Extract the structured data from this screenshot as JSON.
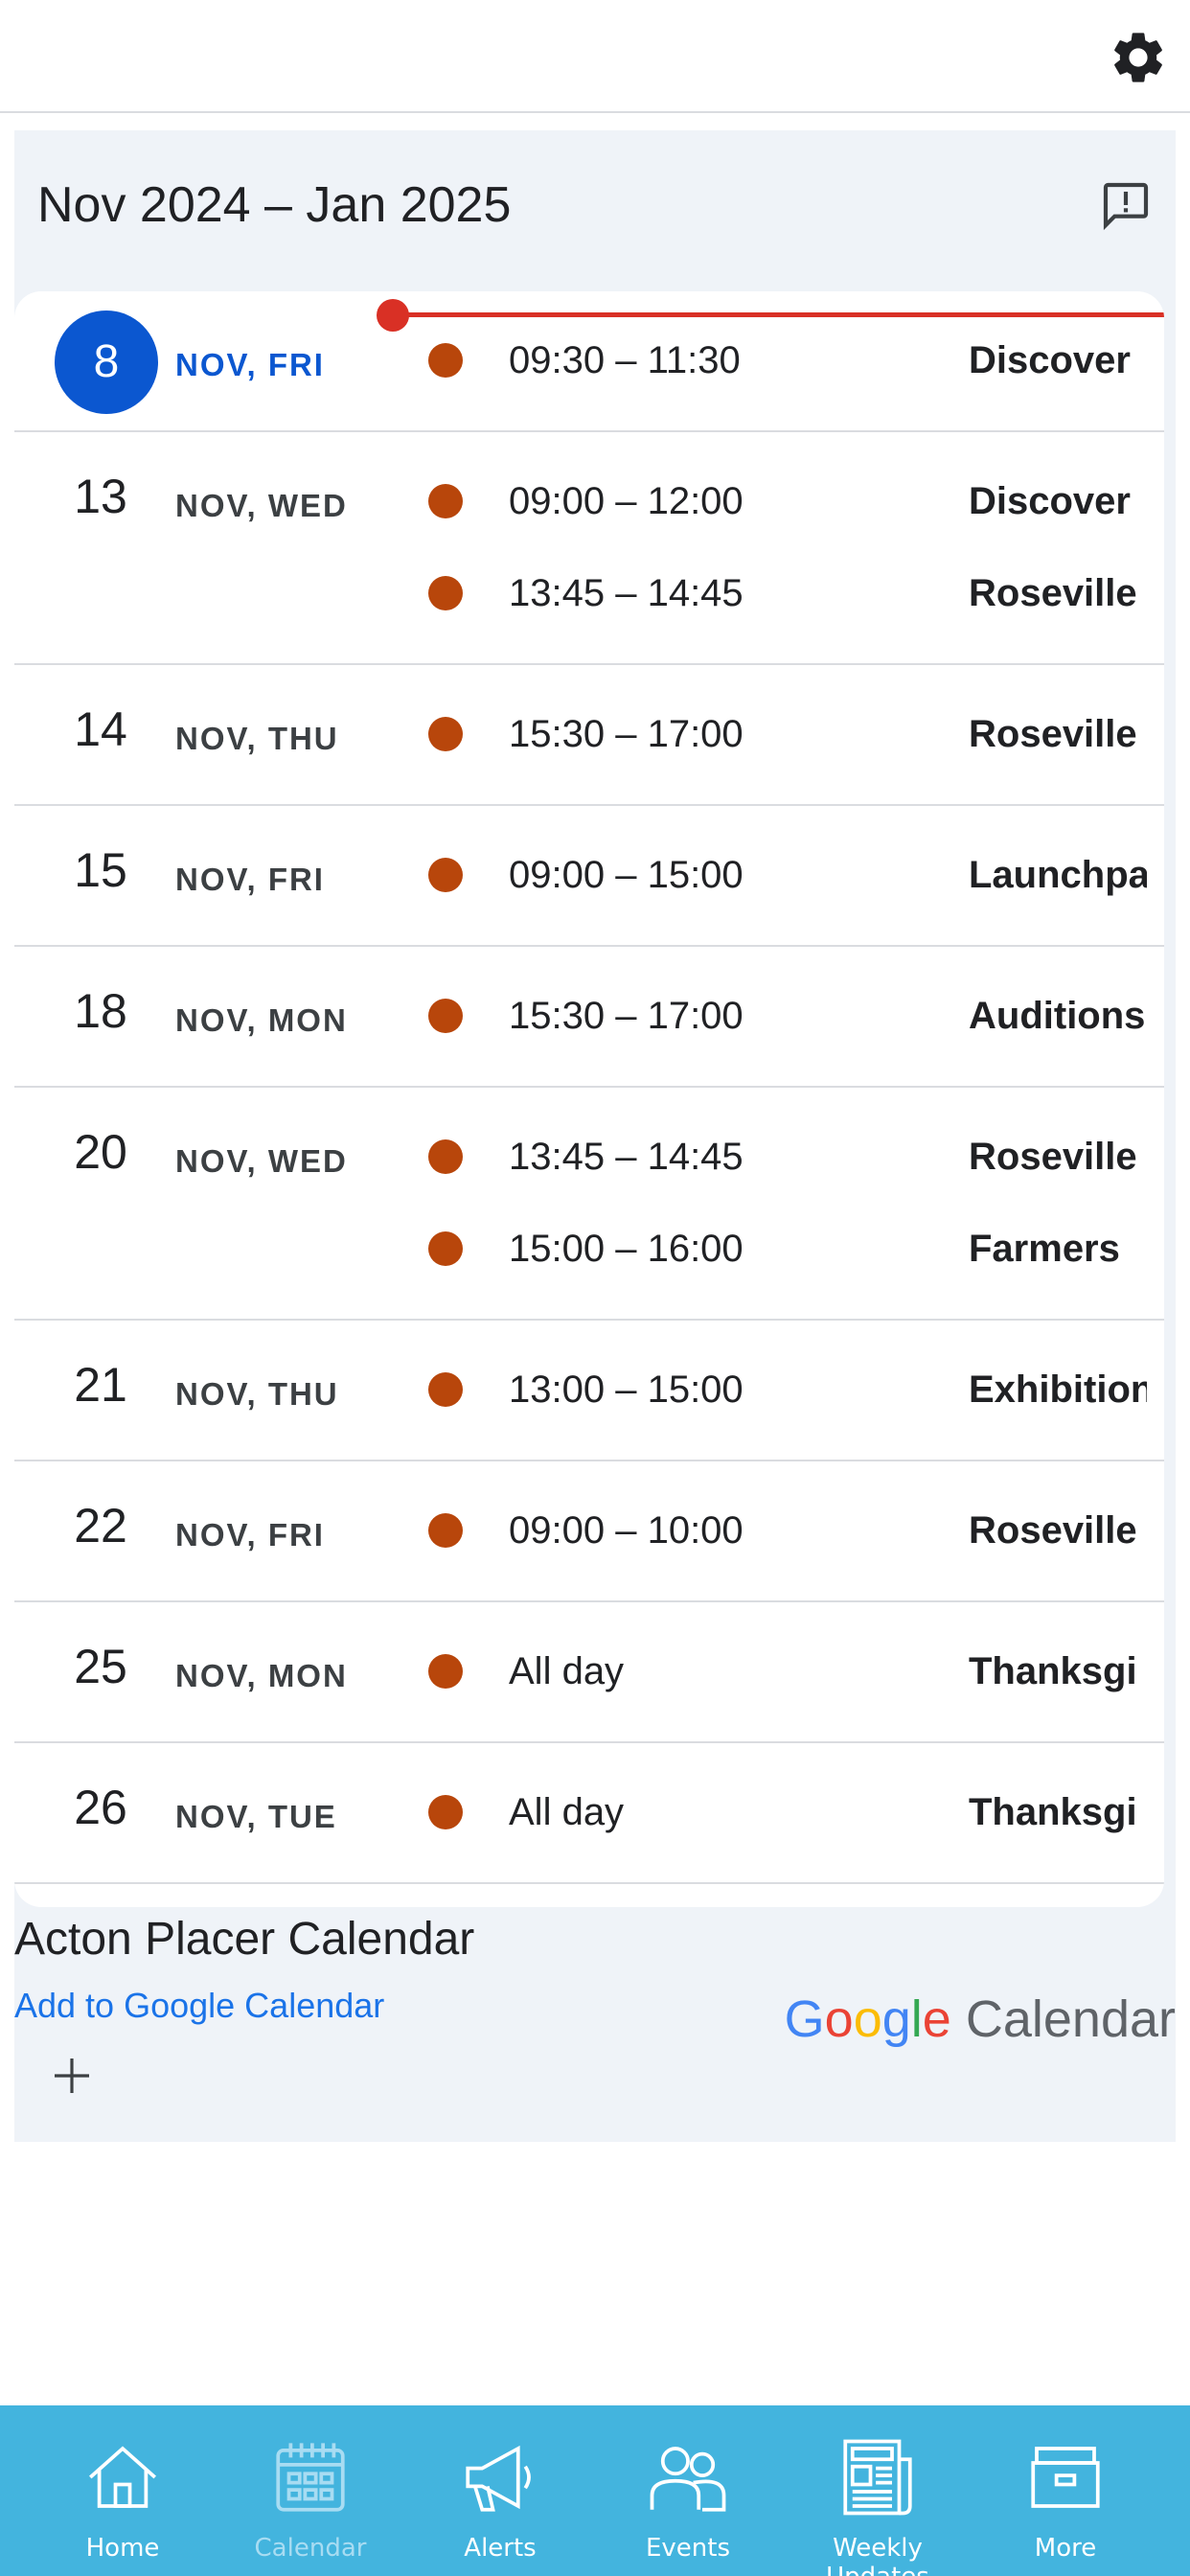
{
  "header": {
    "settings_icon": "gear-icon"
  },
  "calendar": {
    "range_title": "Nov 2024 – Jan 2025",
    "feedback_icon": "feedback-icon",
    "days": [
      {
        "num": "8",
        "dow": "NOV, FRI",
        "today": true,
        "events": [
          {
            "time": "09:30 – 11:30",
            "title": "Discover"
          }
        ]
      },
      {
        "num": "13",
        "dow": "NOV, WED",
        "events": [
          {
            "time": "09:00 – 12:00",
            "title": "Discover"
          },
          {
            "time": "13:45 – 14:45",
            "title": "Roseville"
          }
        ]
      },
      {
        "num": "14",
        "dow": "NOV, THU",
        "events": [
          {
            "time": "15:30 – 17:00",
            "title": "Roseville"
          }
        ]
      },
      {
        "num": "15",
        "dow": "NOV, FRI",
        "events": [
          {
            "time": "09:00 – 15:00",
            "title": "Launchpa"
          }
        ]
      },
      {
        "num": "18",
        "dow": "NOV, MON",
        "events": [
          {
            "time": "15:30 – 17:00",
            "title": "Auditions"
          }
        ]
      },
      {
        "num": "20",
        "dow": "NOV, WED",
        "events": [
          {
            "time": "13:45 – 14:45",
            "title": "Roseville"
          },
          {
            "time": "15:00 – 16:00",
            "title": "Farmers"
          }
        ]
      },
      {
        "num": "21",
        "dow": "NOV, THU",
        "events": [
          {
            "time": "13:00 – 15:00",
            "title": "Exhibition"
          }
        ]
      },
      {
        "num": "22",
        "dow": "NOV, FRI",
        "events": [
          {
            "time": "09:00 – 10:00",
            "title": "Roseville"
          }
        ]
      },
      {
        "num": "25",
        "dow": "NOV, MON",
        "events": [
          {
            "time": "All day",
            "title": "Thanksgi"
          }
        ]
      },
      {
        "num": "26",
        "dow": "NOV, TUE",
        "events": [
          {
            "time": "All day",
            "title": "Thanksgi"
          }
        ]
      }
    ],
    "event_color": "#b8460b",
    "today_color": "#0b57d0",
    "now_line_color": "#d93025",
    "calendar_name": "Acton Placer Calendar",
    "add_link": "Add to Google Calendar",
    "google_logo_word": "Calendar",
    "google_letters": [
      "G",
      "o",
      "o",
      "g",
      "l",
      "e"
    ]
  },
  "tabbar": {
    "color": "#43b4de",
    "tabs": [
      {
        "label": "Home",
        "icon": "home-icon"
      },
      {
        "label": "Calendar",
        "icon": "calendar-icon",
        "active": true
      },
      {
        "label": "Alerts",
        "icon": "megaphone-icon"
      },
      {
        "label": "Events",
        "icon": "people-icon"
      },
      {
        "label": "Weekly Updates",
        "icon": "newspaper-icon"
      },
      {
        "label": "More",
        "icon": "drawer-icon"
      }
    ]
  }
}
